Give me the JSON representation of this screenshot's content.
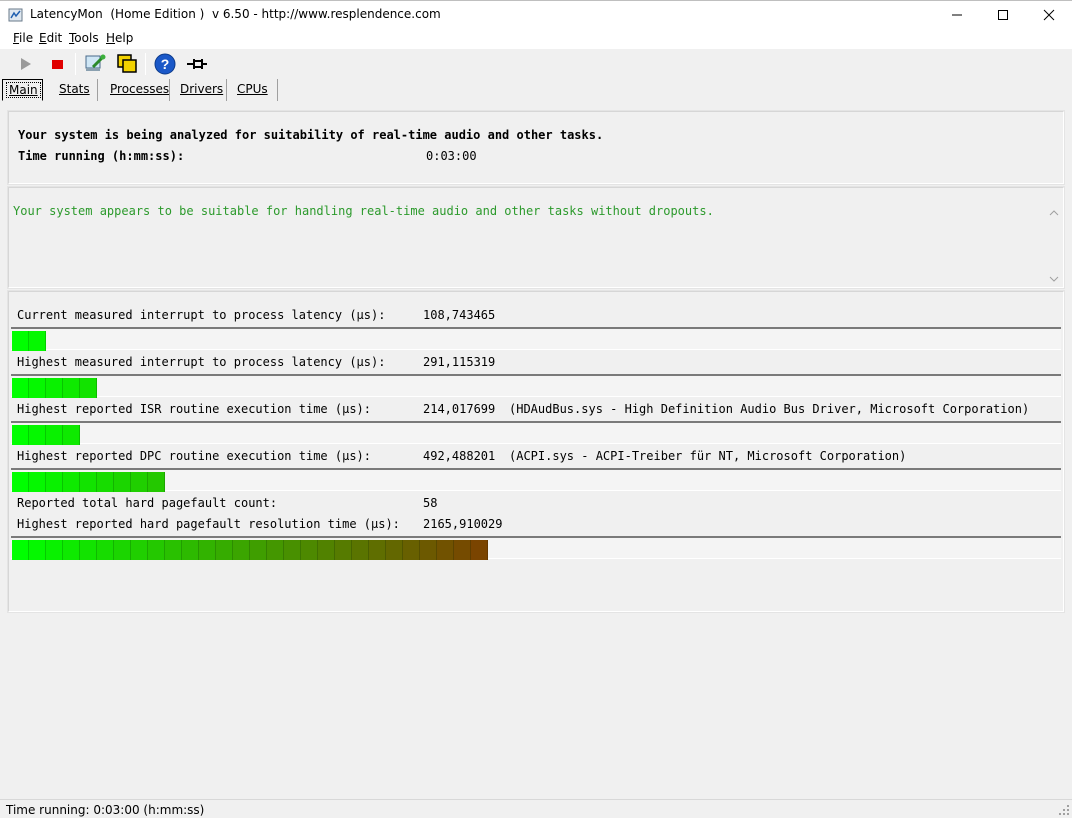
{
  "window": {
    "title": "LatencyMon  (Home Edition )  v 6.50 - http://www.resplendence.com",
    "controls": {
      "minimize": "minimize-icon",
      "maximize": "maximize-icon",
      "close": "close-icon"
    }
  },
  "menu": {
    "items": [
      "File",
      "Edit",
      "Tools",
      "Help"
    ]
  },
  "toolbar": {
    "buttons": [
      "play-icon",
      "stop-icon",
      "driver-scan-icon",
      "copy-windows-icon",
      "help-icon",
      "pin-icon"
    ]
  },
  "tabs": [
    "Main",
    "Stats",
    "Processes",
    "Drivers",
    "CPUs"
  ],
  "analysis": {
    "line1": "Your system is being analyzed for suitability of real-time audio and other tasks.",
    "time_label": "Time running (h:mm:ss):",
    "time_value": "0:03:00"
  },
  "verdict": {
    "text": "Your system appears to be suitable for handling real-time audio and other tasks without dropouts.",
    "color": "#2c9a2c"
  },
  "metrics": [
    {
      "label": "Current measured interrupt to process latency (µs):",
      "value": "108,743465",
      "extra": "",
      "level_segments": 2
    },
    {
      "label": "Highest measured interrupt to process latency (µs):",
      "value": "291,115319",
      "extra": "",
      "level_segments": 5
    },
    {
      "label": "Highest reported ISR routine execution time (µs):",
      "value": "214,017699",
      "extra": "(HDAudBus.sys - High Definition Audio Bus Driver, Microsoft Corporation)",
      "level_segments": 4
    },
    {
      "label": "Highest reported DPC routine execution time (µs):",
      "value": "492,488201",
      "extra": "(ACPI.sys - ACPI-Treiber für NT, Microsoft Corporation)",
      "level_segments": 9
    },
    {
      "label": "Reported total hard pagefault count:",
      "value": "58",
      "extra": "",
      "level_segments": null
    },
    {
      "label": "Highest reported hard pagefault resolution time (µs):",
      "value": "2165,910029",
      "extra": "",
      "level_segments": 28
    }
  ],
  "status": {
    "text": "Time running: 0:03:00  (h:mm:ss)"
  }
}
